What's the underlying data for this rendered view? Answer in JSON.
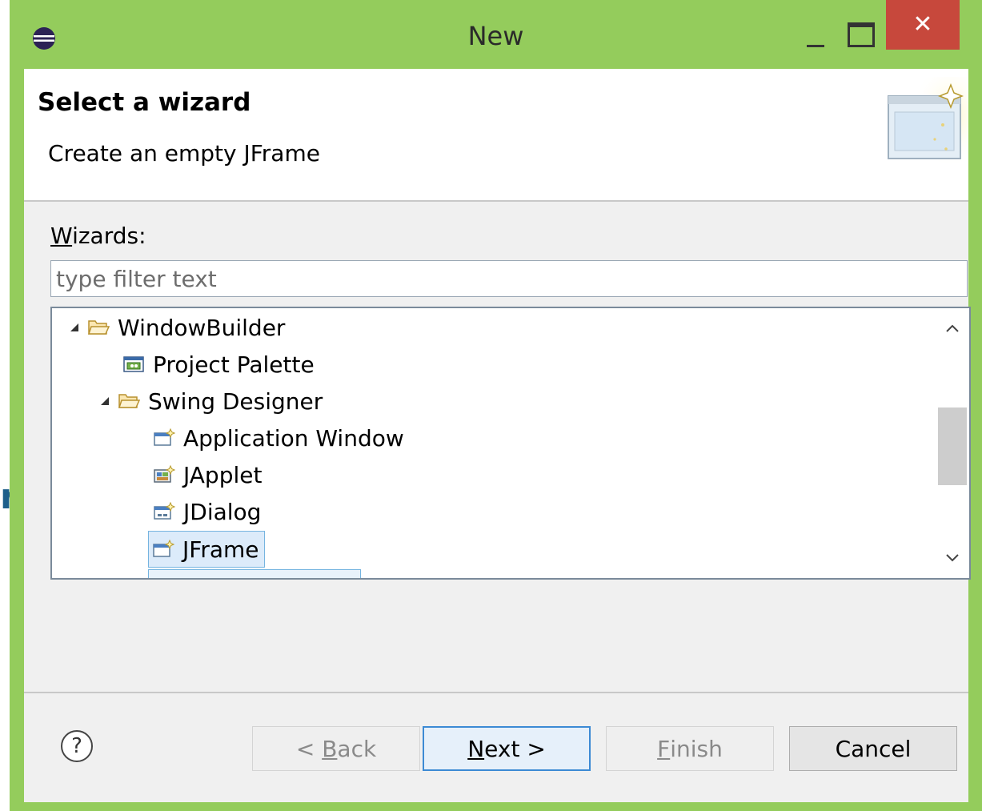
{
  "window": {
    "title": "New",
    "close_label": "✕"
  },
  "header": {
    "title": "Select a wizard",
    "description": "Create an empty JFrame"
  },
  "wizards": {
    "label_accel": "W",
    "label_rest": "izards:",
    "filter_placeholder": "type filter text",
    "tree": [
      {
        "label": "WindowBuilder",
        "icon": "folder-open-icon",
        "expanded": true,
        "selected": false
      },
      {
        "label": "Project Palette",
        "icon": "palette-icon",
        "selected": false
      },
      {
        "label": "Swing Designer",
        "icon": "folder-open-icon",
        "expanded": true,
        "selected": false
      },
      {
        "label": "Application Window",
        "icon": "window-wizard-icon",
        "selected": false
      },
      {
        "label": "JApplet",
        "icon": "applet-wizard-icon",
        "selected": false
      },
      {
        "label": "JDialog",
        "icon": "dialog-wizard-icon",
        "selected": false
      },
      {
        "label": "JFrame",
        "icon": "frame-wizard-icon",
        "selected": true
      }
    ]
  },
  "buttons": {
    "help": "?",
    "back_prefix": "< ",
    "back_accel": "B",
    "back_rest": "ack",
    "next_accel": "N",
    "next_rest": "ext >",
    "finish_accel": "F",
    "finish_rest": "inish",
    "cancel": "Cancel"
  },
  "colors": {
    "title_bar": "#94cc5c",
    "close_button": "#c7483c",
    "selection_border": "#75b4e0",
    "default_button_border": "#3c8ad4"
  }
}
